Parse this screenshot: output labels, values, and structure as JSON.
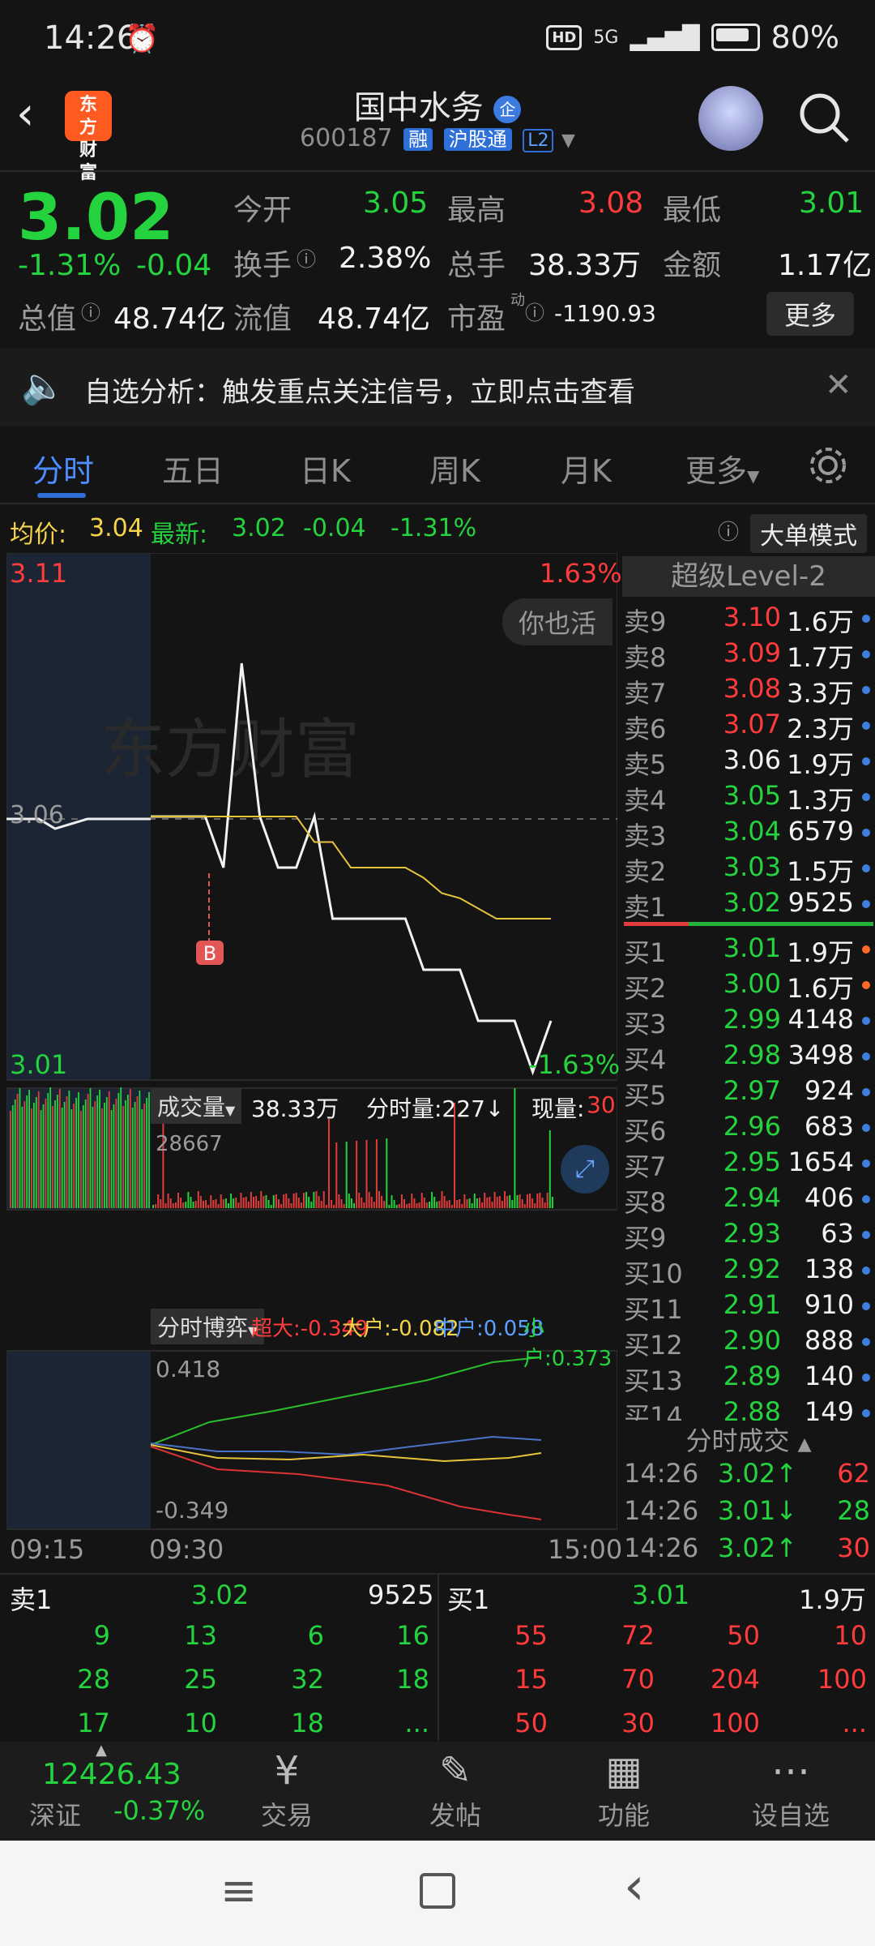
{
  "status": {
    "time": "14:26",
    "signal": "5G",
    "hd": "HD",
    "battery": "80%"
  },
  "header": {
    "logo_text": "东方财富",
    "title": "国中水务",
    "title_badge": "企",
    "code": "600187",
    "tags": [
      "融",
      "沪股通",
      "L2"
    ]
  },
  "quote": {
    "price": "3.02",
    "change_pct": "-1.31%",
    "change": "-0.04",
    "open_label": "今开",
    "open": "3.05",
    "high_label": "最高",
    "high": "3.08",
    "low_label": "最低",
    "low": "3.01",
    "turnover_label": "换手",
    "turnover": "2.38%",
    "volume_label": "总手",
    "volume": "38.33万",
    "amount_label": "金额",
    "amount": "1.17亿",
    "mcap_label": "总值",
    "mcap": "48.74亿",
    "float_label": "流值",
    "float": "48.74亿",
    "pe_label": "市盈",
    "pe_sup": "动",
    "pe": "-1190.93",
    "more_label": "更多"
  },
  "notice": {
    "text": "自选分析：触发重点关注信号，立即点击查看"
  },
  "tabs": [
    "分时",
    "五日",
    "日K",
    "周K",
    "月K",
    "更多"
  ],
  "avg": {
    "avg_label": "均价:",
    "avg": "3.04",
    "latest_label": "最新:",
    "latest": "3.02",
    "chg": "-0.04",
    "pct": "-1.31%",
    "mode_label": "大单模式"
  },
  "chart_labels": {
    "top_price": "3.11",
    "top_pct": "1.63%",
    "mid_price": "3.06",
    "low_price": "3.01",
    "low_pct": "-1.63%",
    "level2": "超级Level-2",
    "chat_hint": "你也活",
    "vol_label": "成交量",
    "vol_total": "38.33万",
    "tick_vol": "分时量:227↓",
    "now_vol_label": "现量:",
    "now_vol": "30",
    "vol_max": "28667",
    "game_label": "分时博弈",
    "super": "超大:-0.349",
    "big": "大户:-0.082",
    "mid": "中户:0.058",
    "small": "小户:0.373",
    "game_max": "0.418",
    "game_min": "-0.349",
    "t_start": "09:15",
    "t_open": "09:30",
    "t_end": "15:00",
    "b_marker": "B"
  },
  "orderbook": {
    "sell": [
      [
        "卖9",
        "3.10",
        "1.6万"
      ],
      [
        "卖8",
        "3.09",
        "1.7万"
      ],
      [
        "卖7",
        "3.08",
        "3.3万"
      ],
      [
        "卖6",
        "3.07",
        "2.3万"
      ],
      [
        "卖5",
        "3.06",
        "1.9万"
      ],
      [
        "卖4",
        "3.05",
        "1.3万"
      ],
      [
        "卖3",
        "3.04",
        "6579"
      ],
      [
        "卖2",
        "3.03",
        "1.5万"
      ],
      [
        "卖1",
        "3.02",
        "9525"
      ]
    ],
    "buy": [
      [
        "买1",
        "3.01",
        "1.9万"
      ],
      [
        "买2",
        "3.00",
        "1.6万"
      ],
      [
        "买3",
        "2.99",
        "4148"
      ],
      [
        "买4",
        "2.98",
        "3498"
      ],
      [
        "买5",
        "2.97",
        "924"
      ],
      [
        "买6",
        "2.96",
        "683"
      ],
      [
        "买7",
        "2.95",
        "1654"
      ],
      [
        "买8",
        "2.94",
        "406"
      ],
      [
        "买9",
        "2.93",
        "63"
      ],
      [
        "买10",
        "2.92",
        "138"
      ],
      [
        "买11",
        "2.91",
        "910"
      ],
      [
        "买12",
        "2.90",
        "888"
      ],
      [
        "买13",
        "2.89",
        "140"
      ],
      [
        "买14",
        "2.88",
        "149"
      ]
    ],
    "trades_label": "分时成交",
    "trades": [
      [
        "14:26",
        "3.02↑",
        "62"
      ],
      [
        "14:26",
        "3.01↓",
        "28"
      ],
      [
        "14:26",
        "3.02↑",
        "30"
      ]
    ]
  },
  "bottom": {
    "sell_label": "卖1",
    "sell_price": "3.02",
    "sell_vol": "9525",
    "buy_label": "买1",
    "buy_price": "3.01",
    "buy_vol": "1.9万",
    "sell_queue": [
      [
        "9",
        "13",
        "6",
        "16"
      ],
      [
        "28",
        "25",
        "32",
        "18"
      ],
      [
        "17",
        "10",
        "18",
        "..."
      ]
    ],
    "buy_queue": [
      [
        "55",
        "72",
        "50",
        "10"
      ],
      [
        "15",
        "70",
        "204",
        "100"
      ],
      [
        "50",
        "30",
        "100",
        "..."
      ]
    ]
  },
  "nav": {
    "index_value": "12426.43",
    "index_name": "深证",
    "index_pct": "-0.37%",
    "items": [
      "交易",
      "发帖",
      "功能",
      "设自选"
    ]
  },
  "chart_data": {
    "type": "line",
    "x": [
      "09:15",
      "09:30",
      "15:00"
    ],
    "ylim": [
      3.01,
      3.11
    ],
    "series": [
      {
        "values": [
          3.06,
          3.06,
          3.06,
          3.06,
          3.05,
          3.09,
          3.06,
          3.05,
          3.05,
          3.06,
          3.04,
          3.04,
          3.04,
          3.04,
          3.04,
          3.03,
          3.03,
          3.03,
          3.02,
          3.02,
          3.02,
          3.01,
          3.02
        ]
      }
    ],
    "avg_values": [
      3.06,
      3.06,
      3.06,
      3.06,
      3.06,
      3.06,
      3.06,
      3.06,
      3.06,
      3.055,
      3.055,
      3.05,
      3.05,
      3.05,
      3.05,
      3.048,
      3.045,
      3.044,
      3.042,
      3.04,
      3.04,
      3.04,
      3.04
    ]
  }
}
